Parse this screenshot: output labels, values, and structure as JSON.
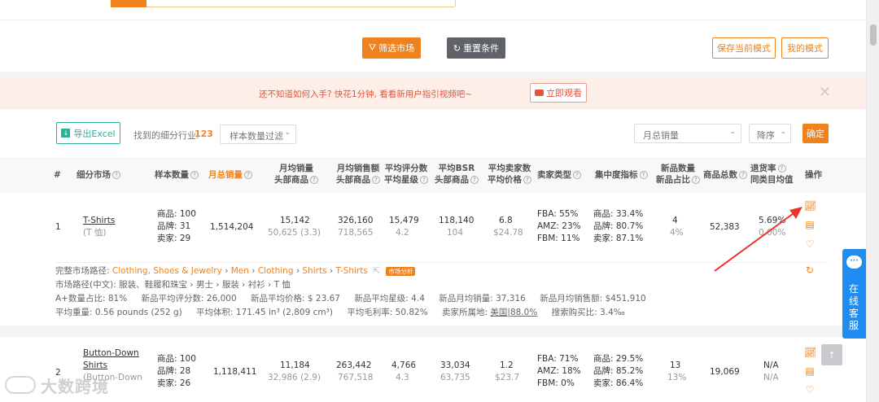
{
  "filter_bar": {
    "filter_button": "筛选市场",
    "reset_button": "重置条件",
    "save_mode": "保存当前模式",
    "my_mode": "我的模式"
  },
  "banner": {
    "text": "还不知道如何入手? 快花1分钟, 看看新用户指引视频吧~",
    "watch_button": "立即观看"
  },
  "toolbar": {
    "export": "导出Excel",
    "found_label": "找到的细分行业:",
    "found_count": "123",
    "sample_filter": "样本数量过滤",
    "sort_field": "月总销量",
    "sort_order": "降序",
    "confirm": "确定"
  },
  "headers": {
    "index": "#",
    "market": "细分市场",
    "samples": "样本数量",
    "monthly_total": "月总销量",
    "avg_sales_1": "月均销量",
    "avg_sales_2": "头部商品",
    "avg_revenue_1": "月均销售额",
    "avg_revenue_2": "头部商品",
    "rating_1": "平均评分数",
    "rating_2": "平均星级",
    "bsr_1": "平均BSR",
    "bsr_2": "头部商品",
    "sellers_1": "平均卖家数",
    "sellers_2": "平均价格",
    "seller_type": "卖家类型",
    "concentration": "集中度指标",
    "new_1": "新品数量",
    "new_2": "新品占比",
    "total_products": "商品总数",
    "return_1": "退货率",
    "return_2": "同类目均值",
    "actions": "操作"
  },
  "rows": [
    {
      "index": "1",
      "name": "T-Shirts",
      "name_cn": "(T 恤)",
      "samples": [
        "商品: 100",
        "品牌: 31",
        "卖家: 29"
      ],
      "monthly_total": "1,514,204",
      "avg_sales": "15,142",
      "avg_sales_sub": "50,625 (3.3)",
      "avg_revenue": "326,160",
      "avg_revenue_sub": "718,565",
      "rating": "15,479",
      "rating_sub": "4.2",
      "bsr": "118,140",
      "bsr_sub": "104",
      "sellers": "6.8",
      "sellers_sub": "$24.78",
      "seller_type": [
        "FBA: 55%",
        "AMZ: 23%",
        "FBM: 11%"
      ],
      "concentration": [
        "商品: 33.4%",
        "品牌: 80.7%",
        "卖家: 87.1%"
      ],
      "new_count": "4",
      "new_ratio": "4%",
      "total_products": "52,383",
      "return_rate": "5.69%",
      "return_avg": "0.00%"
    },
    {
      "index": "2",
      "name": "Button-Down",
      "name_2": "Shirts",
      "name_cn": "(Button-Down",
      "samples": [
        "商品: 100",
        "品牌: 28",
        "卖家: 26"
      ],
      "monthly_total": "1,118,411",
      "avg_sales": "11,184",
      "avg_sales_sub": "32,986 (2.9)",
      "avg_revenue": "263,442",
      "avg_revenue_sub": "767,518",
      "rating": "4,766",
      "rating_sub": "4.3",
      "bsr": "33,034",
      "bsr_sub": "63,735",
      "sellers": "1.2",
      "sellers_sub": "$23.7",
      "seller_type": [
        "FBA: 71%",
        "AMZ: 18%",
        "FBM: 0%"
      ],
      "concentration": [
        "商品: 29.5%",
        "品牌: 85.2%",
        "卖家: 86.4%"
      ],
      "new_count": "13",
      "new_ratio": "13%",
      "total_products": "19,069",
      "return_rate": "N/A",
      "return_avg": "N/A"
    }
  ],
  "detail": {
    "path_label": "完整市场路径:",
    "path": [
      "Clothing, Shoes & Jewelry",
      "Men",
      "Clothing",
      "Shirts",
      "T-Shirts"
    ],
    "sep": "›",
    "analysis_tag": "市场分析",
    "path_cn": "市场路径(中文): 服装、鞋履和珠宝 › 男士 › 服装 › 衬衫 › T 恤",
    "line3": [
      "A+数量占比: 81%",
      "新品平均评分数: 26,000",
      "新品平均价格: $ 23.67",
      "新品平均星级: 4.4",
      "新品月均销量: 37,316",
      "新品月均销售额: $451,910"
    ],
    "line4": [
      "平均重量: 0.56 pounds (252 g)",
      "平均体积: 171.45 in³ (2,809 cm³)",
      "平均毛利率: 50.82%"
    ],
    "origin_label": "卖家所属地:",
    "origin_value": "美国|88.0%",
    "search_ratio": "搜索购买比: 3.4‰"
  },
  "side_service": "在线客服",
  "watermark": "大数跨境"
}
